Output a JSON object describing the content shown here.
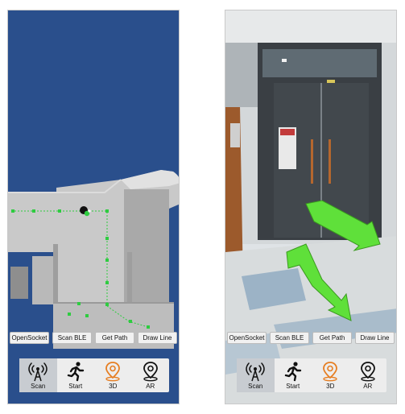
{
  "screens": [
    {
      "buttons": [
        "OpenSocket",
        "Scan BLE",
        "Get Path",
        "Draw Line"
      ],
      "nav": [
        {
          "label": "Scan",
          "icon": "antenna-icon",
          "active": true
        },
        {
          "label": "Start",
          "icon": "running-person-icon",
          "active": false
        },
        {
          "label": "3D",
          "icon": "location-pin-3d-icon",
          "active": false
        },
        {
          "label": "AR",
          "icon": "location-pin-ar-icon",
          "active": false
        }
      ]
    },
    {
      "buttons": [
        "OpenSocket",
        "Scan BLE",
        "Get Path",
        "Draw Line"
      ],
      "nav": [
        {
          "label": "Scan",
          "icon": "antenna-icon",
          "active": true
        },
        {
          "label": "Start",
          "icon": "running-person-icon",
          "active": false
        },
        {
          "label": "3D",
          "icon": "location-pin-3d-icon",
          "active": false
        },
        {
          "label": "AR",
          "icon": "location-pin-ar-icon",
          "active": false
        }
      ]
    }
  ],
  "colors": {
    "map_background": "#2a4f8c",
    "path_marker": "#2ecc40",
    "ar_arrow": "#5fe03a",
    "active_icon": "#e67e22"
  }
}
